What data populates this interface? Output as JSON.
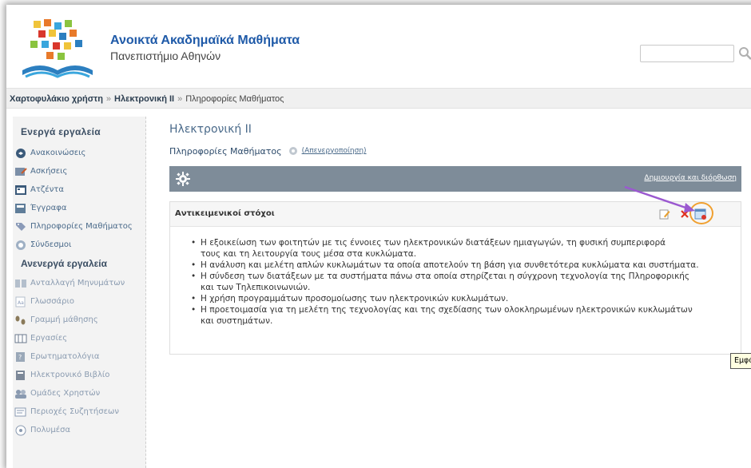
{
  "header": {
    "title": "Ανοικτά Ακαδημαϊκά Μαθήματα",
    "subtitle": "Πανεπιστήμιο Αθηνών",
    "search_placeholder": "",
    "logo_icon": "open-book-logo-icon",
    "colors": {
      "title": "#1f5aa8"
    }
  },
  "breadcrumb": {
    "items": [
      "Χαρτοφυλάκιο χρήστη",
      "Ηλεκτρονική ΙΙ",
      "Πληροφορίες Μαθήματος"
    ],
    "separator": "»"
  },
  "sidebar": {
    "active_heading": "Ενεργά εργαλεία",
    "active_items": [
      {
        "label": "Ανακοινώσεις",
        "icon": "announcement-icon"
      },
      {
        "label": "Ασκήσεις",
        "icon": "exercises-icon"
      },
      {
        "label": "Ατζέντα",
        "icon": "agenda-icon"
      },
      {
        "label": "Έγγραφα",
        "icon": "documents-icon"
      },
      {
        "label": "Πληροφορίες Μαθήματος",
        "icon": "course-info-icon"
      },
      {
        "label": "Σύνδεσμοι",
        "icon": "links-icon"
      }
    ],
    "inactive_heading": "Ανενεργά εργαλεία",
    "inactive_items": [
      {
        "label": "Ανταλλαγή Μηνυμάτων",
        "icon": "messages-icon"
      },
      {
        "label": "Γλωσσάριο",
        "icon": "glossary-icon"
      },
      {
        "label": "Γραμμή μάθησης",
        "icon": "learning-path-icon"
      },
      {
        "label": "Εργασίες",
        "icon": "assignments-icon"
      },
      {
        "label": "Ερωτηματολόγια",
        "icon": "questionnaire-icon"
      },
      {
        "label": "Ηλεκτρονικό Βιβλίο",
        "icon": "ebook-icon"
      },
      {
        "label": "Ομάδες Χρηστών",
        "icon": "user-groups-icon"
      },
      {
        "label": "Περιοχές Συζητήσεων",
        "icon": "forums-icon"
      },
      {
        "label": "Πολυμέσα",
        "icon": "multimedia-icon"
      }
    ]
  },
  "main": {
    "course_title": "Ηλεκτρονική ΙΙ",
    "page_title": "Πληροφορίες Μαθήματος",
    "deactivate_label": "(Απενεργοποίηση)",
    "toolbar_link": "Δημιουργία και διόρθωση",
    "panel": {
      "title": "Αντικειμενικοί στόχοι",
      "goals": [
        "Η εξοικείωση των φοιτητών με τις έννοιες των ηλεκτρονικών διατάξεων ημιαγωγών, τη φυσική συμπεριφορά",
        "τους και τη λειτουργία τους μέσα στα κυκλώματα.",
        "Η ανάλυση και μελέτη απλών κυκλωμάτων τα οποία αποτελούν τη βάση για συνθετότερα κυκλώματα και συστήματα.",
        "Η σύνδεση των διατάξεων με τα συστήματα πάνω στα οποία στηρίζεται η σύγχρονη τεχνολογία της Πληροφορικής",
        "και των Τηλεπικοινωνιών.",
        "Η χρήση προγραμμάτων προσομοίωσης των ηλεκτρονικών κυκλωμάτων.",
        "Η προετοιμασία για τη μελέτη της τεχνολογίας και της σχεδίασης των ολοκληρωμένων ηλεκτρονικών κυκλωμάτων",
        "και συστημάτων."
      ],
      "bullets": [
        true,
        false,
        true,
        true,
        false,
        true,
        true,
        false
      ]
    },
    "tooltip": "Εμφάνιση / Απόκρυψη στην κεντρική σελίδα"
  },
  "colors": {
    "toolbar_bg": "#7e8c99",
    "highlight": "#f0a030",
    "arrow": "#9b59d0"
  }
}
